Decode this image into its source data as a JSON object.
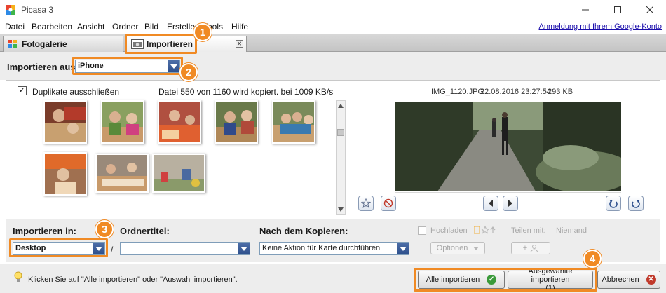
{
  "window": {
    "title": "Picasa 3",
    "controls": [
      "minimize",
      "maximize",
      "close"
    ]
  },
  "menu": {
    "items": [
      "Datei",
      "Bearbeiten",
      "Ansicht",
      "Ordner",
      "Bild",
      "Erstellen",
      "Tools",
      "Hilfe"
    ],
    "google_link": "Anmeldung mit Ihrem Google-Konto"
  },
  "tabs": [
    {
      "label": "Fotogalerie",
      "icon": "gallery-grid-icon"
    },
    {
      "label": "Importieren",
      "icon": "import-camera-icon"
    }
  ],
  "source": {
    "label": "Importieren aus",
    "value": "iPhone"
  },
  "main": {
    "duplicates_label": "Duplikate ausschließen",
    "duplicates_checked": true,
    "status": "Datei 550 von 1160 wird kopiert. bei 1009 KB/s",
    "file_name": "IMG_1120.JPG",
    "file_date": "22.08.2016 23:27:54",
    "file_size": "293 KB"
  },
  "bottom": {
    "import_to_label": "Importieren in:",
    "import_to_value": "Desktop",
    "folder_title_label": "Ordnertitel:",
    "folder_title_value": "",
    "separator": "/",
    "after_copy_label": "Nach dem Kopieren:",
    "after_copy_value": "Keine Aktion für Karte durchführen",
    "upload_label": "Hochladen",
    "share_label": "Teilen mit:",
    "share_value": "Niemand",
    "options_label": "Optionen",
    "add_label": "+"
  },
  "footer": {
    "hint": "Klicken Sie auf \"Alle importieren\" oder \"Auswahl importieren\".",
    "import_all": "Alle importieren",
    "import_selected_line1": "Ausgewählte importieren",
    "import_selected_line2": "(1)",
    "cancel": "Abbrechen"
  },
  "annotations": [
    "1",
    "2",
    "3",
    "4"
  ],
  "colors": {
    "highlight": "#f08a24",
    "link": "#1a0dab",
    "select_arrow": "#2d4f8c",
    "ok_green": "#3a9a3a",
    "cancel_red": "#c0392b"
  }
}
